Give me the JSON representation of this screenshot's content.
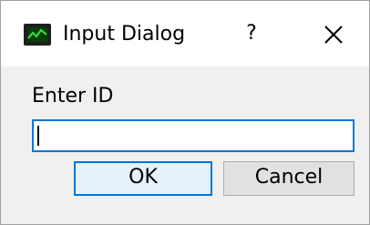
{
  "window": {
    "title": "Input Dialog",
    "app_icon": "terminal-chart-icon",
    "help_label": "?",
    "close_icon": "close-icon"
  },
  "dialog": {
    "prompt_label": "Enter ID",
    "input_value": "",
    "ok_label": "OK",
    "cancel_label": "Cancel"
  },
  "colors": {
    "focus_accent": "#0078d7",
    "client_background": "#f0f0f0",
    "button_background": "#e1e1e1"
  }
}
